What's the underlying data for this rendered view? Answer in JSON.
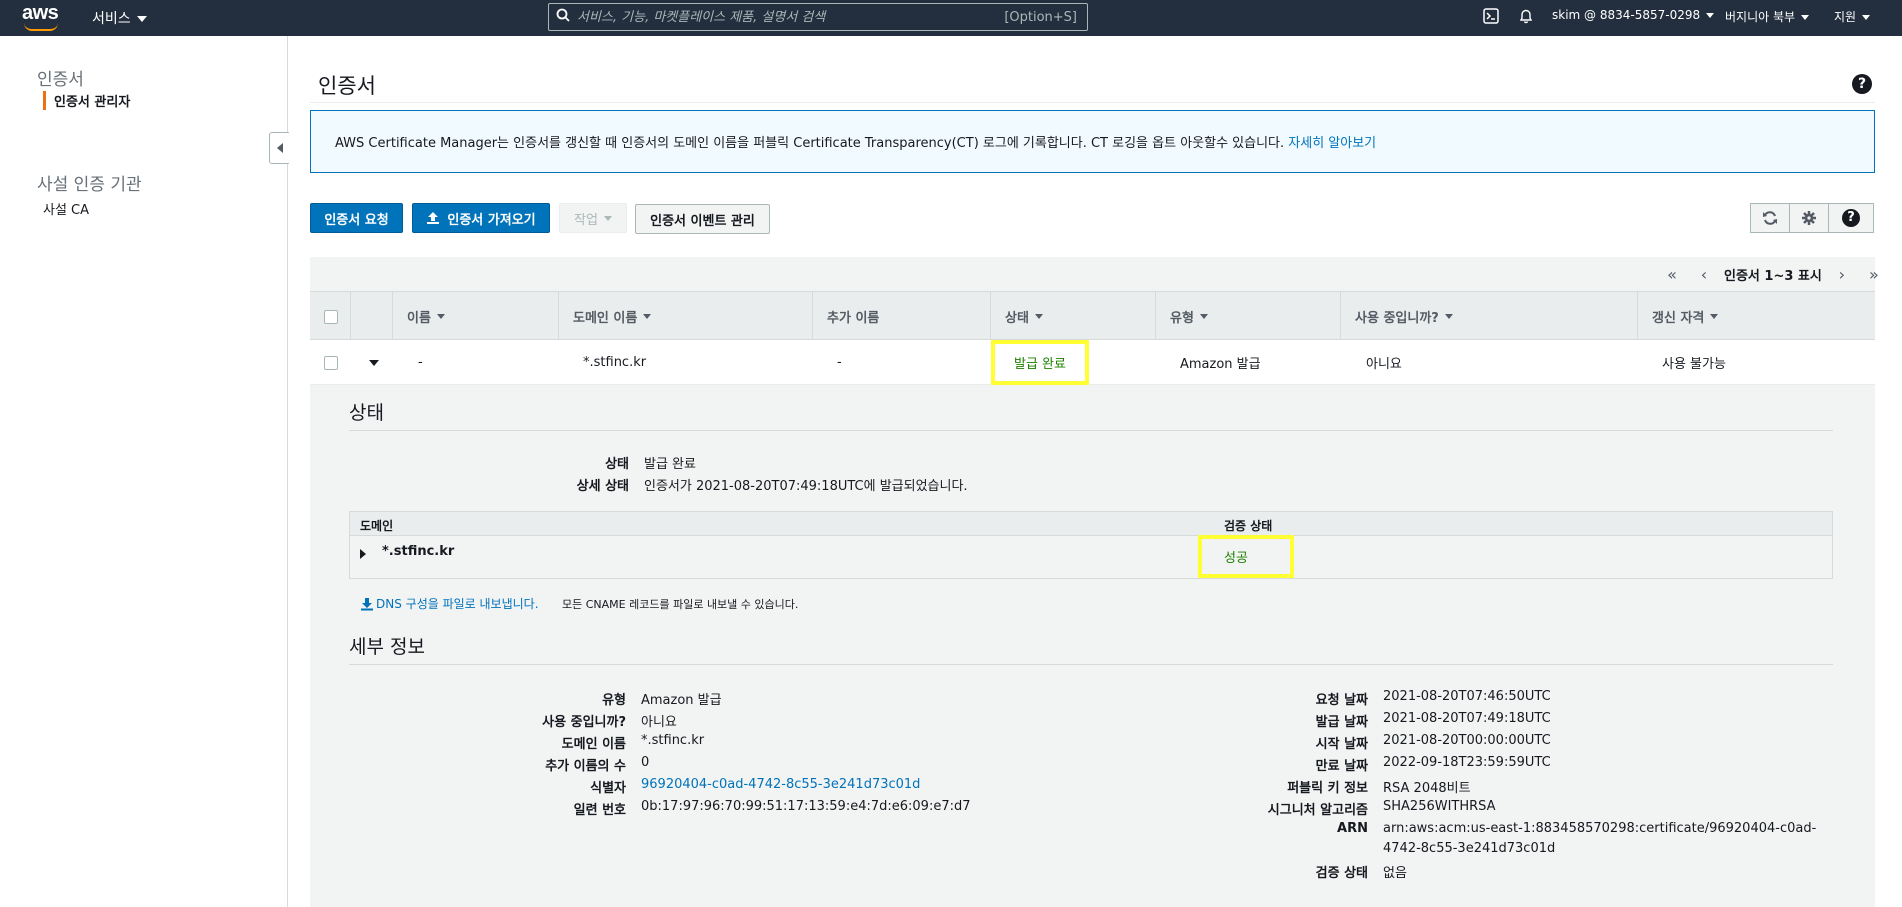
{
  "topnav": {
    "logo": "aws",
    "services_label": "서비스",
    "search_placeholder": "서비스, 기능, 마켓플레이스 제품, 설명서 검색",
    "search_shortcut": "[Option+S]",
    "account_label": "skim @ 8834-5857-0298",
    "region_label": "버지니아 북부",
    "support_label": "지원",
    "icons": [
      "cloudshell-icon",
      "bell-icon"
    ]
  },
  "sidebar": {
    "section1_title": "인증서",
    "item_manager": "인증서 관리자",
    "section2_title": "사설 인증 기관",
    "item_private_ca": "사설 CA"
  },
  "main": {
    "title": "인증서",
    "info_text": "AWS Certificate Manager는 인증서를 갱신할 때 인증서의 도메인 이름을 퍼블릭 Certificate Transparency(CT) 로그에 기록합니다. CT 로깅을 옵트 아웃할수 있습니다. ",
    "info_link": "자세히 알아보기",
    "buttons": {
      "request": "인증서 요청",
      "import": "인증서 가져오기",
      "actions": "작업",
      "events": "인증서 이벤트 관리"
    },
    "pager_label": "인증서 1~3 표시"
  },
  "table": {
    "columns": [
      "이름",
      "도메인 이름",
      "추가 이름",
      "상태",
      "유형",
      "사용 중입니까?",
      "갱신 자격"
    ],
    "row": {
      "name": "-",
      "domain": "*.stfinc.kr",
      "additional": "-",
      "status": "발급 완료",
      "type": "Amazon 발급",
      "in_use": "아니요",
      "renewal": "사용 불가능"
    }
  },
  "status_section": {
    "title": "상태",
    "status_label": "상태",
    "status_value": "발급 완료",
    "detail_label": "상세 상태",
    "detail_value": "인증서가 2021-08-20T07:49:18UTC에 발급되었습니다.",
    "domain_col": "도메인",
    "validation_col": "검증 상태",
    "domain_value": "*.stfinc.kr",
    "validation_value": "성공",
    "export_link": "DNS 구성을 파일로 내보냅니다.",
    "export_note": "모든 CNAME 레코드를 파일로 내보낼 수 있습니다."
  },
  "details_section": {
    "title": "세부 정보",
    "left": [
      {
        "label": "유형",
        "value": "Amazon 발급"
      },
      {
        "label": "사용 중입니까?",
        "value": "아니요"
      },
      {
        "label": "도메인 이름",
        "value": "*.stfinc.kr"
      },
      {
        "label": "추가 이름의 수",
        "value": "0"
      },
      {
        "label": "식별자",
        "value": "96920404-c0ad-4742-8c55-3e241d73c01d"
      },
      {
        "label": "일련 번호",
        "value": "0b:17:97:96:70:99:51:17:13:59:e4:7d:e6:09:e7:d7"
      }
    ],
    "right": [
      {
        "label": "요청 날짜",
        "value": "2021-08-20T07:46:50UTC"
      },
      {
        "label": "발급 날짜",
        "value": "2021-08-20T07:49:18UTC"
      },
      {
        "label": "시작 날짜",
        "value": "2021-08-20T00:00:00UTC"
      },
      {
        "label": "만료 날짜",
        "value": "2022-09-18T23:59:59UTC"
      },
      {
        "label": "퍼블릭 키 정보",
        "value": "RSA 2048비트"
      },
      {
        "label": "시그니처 알고리즘",
        "value": "SHA256WITHRSA"
      },
      {
        "label": "ARN",
        "value": "arn:aws:acm:us-east-1:883458570298:certificate/96920404-c0ad-",
        "value2": "4742-8c55-3e241d73c01d"
      },
      {
        "label": "검증 상태",
        "value": "없음"
      }
    ]
  },
  "colors": {
    "nav_bg": "#232f3e",
    "primary": "#0073bb",
    "success": "#1d8102",
    "highlight": "#ffff33",
    "accent": "#ec7211"
  }
}
